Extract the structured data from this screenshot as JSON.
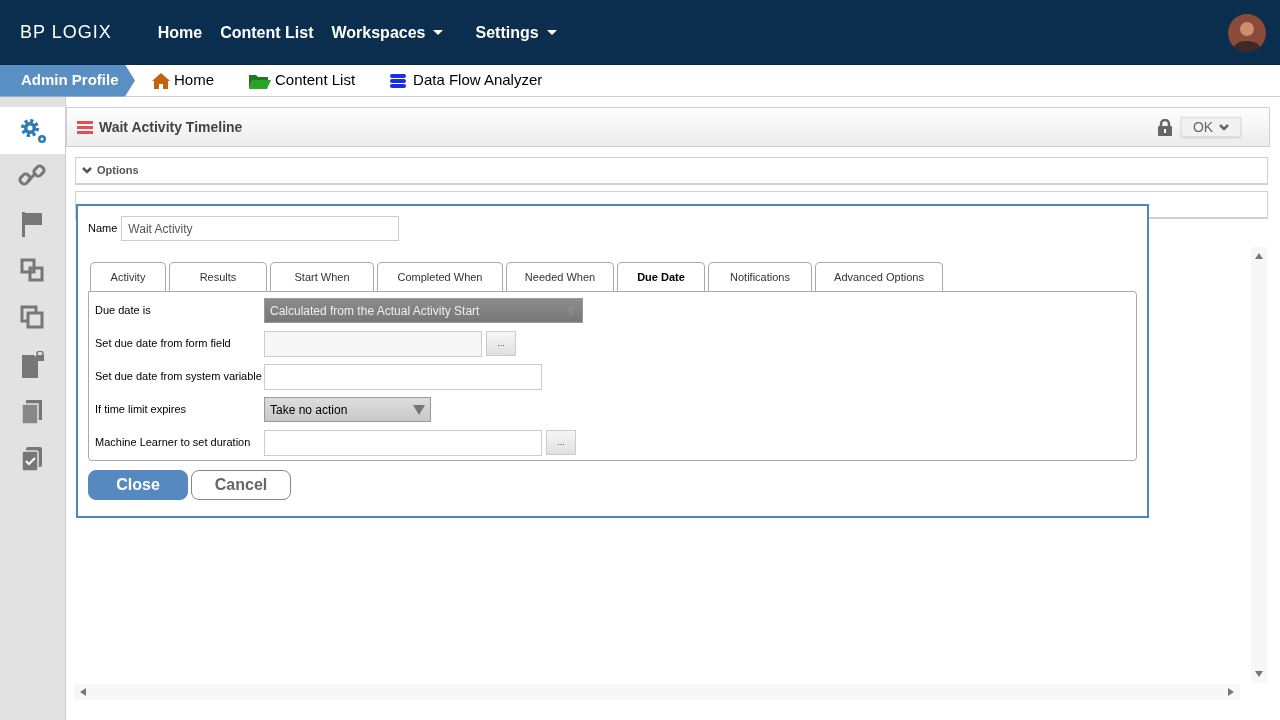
{
  "top_nav": {
    "logo": "BP LOGIX",
    "items": [
      {
        "label": "Home",
        "dropdown": false
      },
      {
        "label": "Content List",
        "dropdown": false
      },
      {
        "label": "Workspaces",
        "dropdown": true
      },
      {
        "label": "Settings",
        "dropdown": true
      }
    ]
  },
  "breadcrumb": {
    "current": "Admin Profile",
    "links": [
      {
        "label": "Home",
        "kind": "home"
      },
      {
        "label": "Content List",
        "kind": "folder"
      },
      {
        "label": "Data Flow Analyzer",
        "kind": "database"
      }
    ]
  },
  "sidebar": {
    "items": [
      {
        "kind": "gears",
        "selected": true
      },
      {
        "kind": "link",
        "selected": false
      },
      {
        "kind": "flag",
        "selected": false
      },
      {
        "kind": "squares",
        "selected": false
      },
      {
        "kind": "layers",
        "selected": false
      },
      {
        "kind": "locked-doc",
        "selected": false
      },
      {
        "kind": "copies",
        "selected": false
      },
      {
        "kind": "check-doc",
        "selected": false
      }
    ]
  },
  "page": {
    "title": "Wait Activity Timeline",
    "ok_button": "OK",
    "panels": [
      {
        "label": "Options"
      }
    ]
  },
  "dialog": {
    "name_label": "Name",
    "name_value": "Wait Activity",
    "tabs": [
      {
        "label": "Activity",
        "selected": false
      },
      {
        "label": "Results",
        "selected": false
      },
      {
        "label": "Start When",
        "selected": false
      },
      {
        "label": "Completed When",
        "selected": false
      },
      {
        "label": "Needed When",
        "selected": false
      },
      {
        "label": "Due Date",
        "selected": true
      },
      {
        "label": "Notifications",
        "selected": false
      },
      {
        "label": "Advanced Options",
        "selected": false
      }
    ],
    "rows": [
      {
        "label": "Due date is",
        "kind": "select",
        "value": "Calculated from the Actual Activity Start",
        "disabled": true
      },
      {
        "label": "Set due date from form field",
        "kind": "browse",
        "disabled": true
      },
      {
        "label": "Set due date from system variable",
        "kind": "field",
        "disabled": false
      },
      {
        "label": "If time limit expires",
        "kind": "select",
        "value": "Take no action",
        "disabled": false
      },
      {
        "label": "Machine Learner to set duration",
        "kind": "browse",
        "disabled": false
      }
    ],
    "browse_label": "...",
    "buttons": [
      {
        "label": "Close",
        "kind": "primary"
      },
      {
        "label": "Cancel",
        "kind": "secondary"
      }
    ]
  }
}
